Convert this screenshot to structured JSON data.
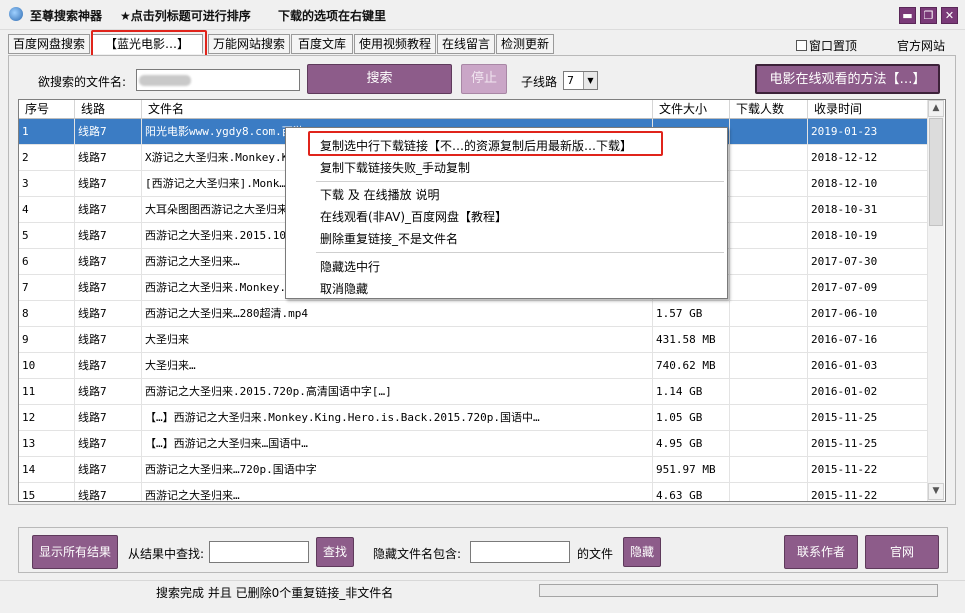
{
  "titlebar": {
    "app_title": "至尊搜索神器",
    "hint_sort": "★点击列标题可进行排序",
    "hint_download": "下载的选项在右键里",
    "min_label": "▬",
    "restore_label": "❐",
    "close_label": "✕"
  },
  "tabs": [
    {
      "label": "百度网盘搜索"
    },
    {
      "label": "【蓝光电影…】"
    },
    {
      "label": "万能网站搜索"
    },
    {
      "label": "百度文库"
    },
    {
      "label": "使用视频教程"
    },
    {
      "label": "在线留言"
    },
    {
      "label": "检测更新"
    }
  ],
  "top_right": {
    "pin_label": "窗口置顶",
    "official_site": "官方网站"
  },
  "search": {
    "label": "欲搜索的文件名:",
    "search_button": "搜索",
    "stop_button": "停止",
    "subline_label": "子线路",
    "subline_value": "7",
    "movie_button": "电影在线观看的方法【…】"
  },
  "grid": {
    "columns": [
      "序号",
      "线路",
      "文件名",
      "文件大小",
      "下载人数",
      "收录时间"
    ],
    "rows": [
      {
        "no": "1",
        "line": "线路7",
        "name": "阳光电影www.ygdy8.com.西游…",
        "size": "",
        "count": "",
        "date": "2019-01-23"
      },
      {
        "no": "2",
        "line": "线路7",
        "name": "X游记之大圣归来.Monkey.K…",
        "size": "",
        "count": "",
        "date": "2018-12-12"
      },
      {
        "no": "3",
        "line": "线路7",
        "name": "[西游记之大圣归来].Monk…",
        "size": "",
        "count": "",
        "date": "2018-12-10"
      },
      {
        "no": "4",
        "line": "线路7",
        "name": "大耳朵图图西游记之大圣归来…",
        "size": "",
        "count": "",
        "date": "2018-10-31"
      },
      {
        "no": "5",
        "line": "线路7",
        "name": "西游记之大圣归来.2015.10…",
        "size": "",
        "count": "",
        "date": "2018-10-19"
      },
      {
        "no": "6",
        "line": "线路7",
        "name": "西游记之大圣归来…",
        "size": "",
        "count": "",
        "date": "2017-07-30"
      },
      {
        "no": "7",
        "line": "线路7",
        "name": "西游记之大圣归来.Monkey.…",
        "size": "",
        "count": "",
        "date": "2017-07-09"
      },
      {
        "no": "8",
        "line": "线路7",
        "name": "西游记之大圣归来…280超清.mp4",
        "size": "1.57 GB",
        "count": "",
        "date": "2017-06-10"
      },
      {
        "no": "9",
        "line": "线路7",
        "name": "大圣归来",
        "size": "431.58 MB",
        "count": "",
        "date": "2016-07-16"
      },
      {
        "no": "10",
        "line": "线路7",
        "name": "大圣归来…",
        "size": "740.62 MB",
        "count": "",
        "date": "2016-01-03"
      },
      {
        "no": "11",
        "line": "线路7",
        "name": "西游记之大圣归来.2015.720p.高清国语中字[…]",
        "size": "1.14 GB",
        "count": "",
        "date": "2016-01-02"
      },
      {
        "no": "12",
        "line": "线路7",
        "name": "【…】西游记之大圣归来.Monkey.King.Hero.is.Back.2015.720p.国语中…",
        "size": "1.05 GB",
        "count": "",
        "date": "2015-11-25"
      },
      {
        "no": "13",
        "line": "线路7",
        "name": "【…】西游记之大圣归来…国语中…",
        "size": "4.95 GB",
        "count": "",
        "date": "2015-11-25"
      },
      {
        "no": "14",
        "line": "线路7",
        "name": "西游记之大圣归来…720p.国语中字",
        "size": "951.97 MB",
        "count": "",
        "date": "2015-11-22"
      },
      {
        "no": "15",
        "line": "线路7",
        "name": "西游记之大圣归来…",
        "size": "4.63 GB",
        "count": "",
        "date": "2015-11-22"
      }
    ]
  },
  "context_menu": {
    "items": [
      "复制选中行下载链接【不…的资源复制后用最新版…下载】",
      "复制下载链接失败_手动复制",
      "下载 及 在线播放 说明",
      "在线观看(非AV)_百度网盘【教程】",
      "删除重复链接_不是文件名",
      "隐藏选中行",
      "取消隐藏"
    ]
  },
  "bottom": {
    "show_all": "显示所有结果",
    "find_label": "从结果中查找:",
    "find_button": "查找",
    "hide_label": "隐藏文件名包含:",
    "of_file": "的文件",
    "hide_button": "隐藏",
    "contact": "联系作者",
    "official": "官网"
  },
  "status": {
    "text": "搜索完成 并且 已删除0个重复链接_非文件名"
  },
  "colors": {
    "accent": "#8d5c8a",
    "selection": "#3b7cc4",
    "highlight_box": "#e0241b"
  }
}
